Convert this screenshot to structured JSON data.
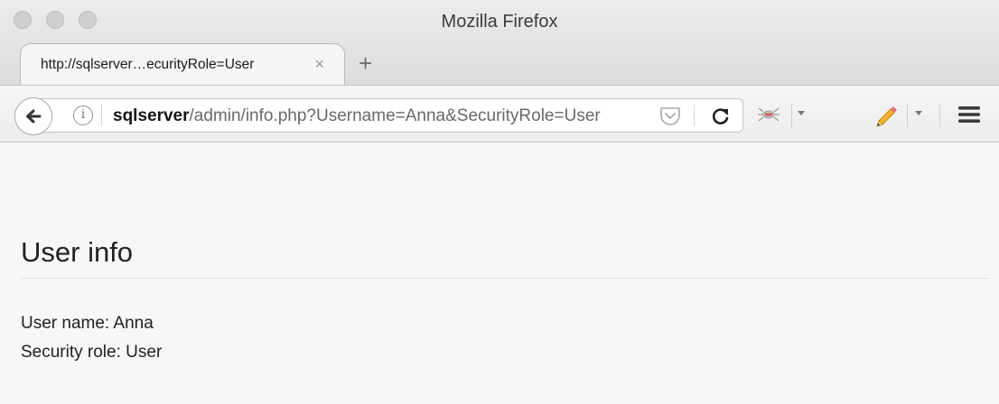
{
  "window": {
    "title": "Mozilla Firefox"
  },
  "tab": {
    "label": "http://sqlserver…ecurityRole=User",
    "close_glyph": "×",
    "new_tab_glyph": "+"
  },
  "toolbar": {
    "url_host": "sqlserver",
    "url_path": "/admin/info.php?Username=Anna&SecurityRole=User",
    "info_glyph": "i",
    "icons": [
      "back-arrow-icon",
      "info-icon",
      "pocket-icon",
      "reload-icon",
      "bug-icon",
      "pencil-icon",
      "hamburger-menu-icon"
    ]
  },
  "page": {
    "heading": "User info",
    "username_line": "User name: Anna",
    "role_line": "Security role: User"
  }
}
